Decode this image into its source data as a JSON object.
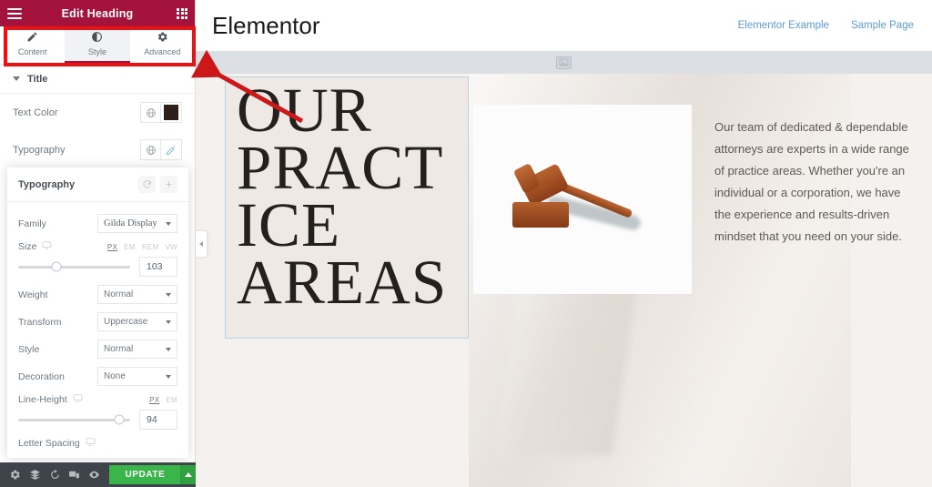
{
  "panel": {
    "header": {
      "title": "Edit Heading",
      "menu_icon": "hamburger-icon",
      "apps_icon": "grid-apps-icon"
    },
    "tabs": [
      {
        "label": "Content",
        "icon": "pencil-icon",
        "active": false
      },
      {
        "label": "Style",
        "icon": "contrast-icon",
        "active": true
      },
      {
        "label": "Advanced",
        "icon": "gear-icon",
        "active": false
      }
    ],
    "section": {
      "label": "Title"
    },
    "controls": [
      {
        "label": "Text Color",
        "globe_icon": "globe-icon",
        "swatch_color": "#2e2019"
      },
      {
        "label": "Typography",
        "globe_icon": "globe-icon",
        "edit_icon": "pencil-edit-icon"
      }
    ],
    "typography_popover": {
      "title": "Typography",
      "reset_icon": "reset-icon",
      "add_icon": "plus-icon",
      "fields": {
        "family": {
          "label": "Family",
          "value": "Gilda Display"
        },
        "size": {
          "label": "Size",
          "responsive_icon": "monitor-icon",
          "units": [
            "PX",
            "EM",
            "REM",
            "VW"
          ],
          "active_unit": "PX",
          "value": "103",
          "slider_percent": 34
        },
        "weight": {
          "label": "Weight",
          "value": "Normal"
        },
        "transform": {
          "label": "Transform",
          "value": "Uppercase"
        },
        "style": {
          "label": "Style",
          "value": "Normal"
        },
        "decoration": {
          "label": "Decoration",
          "value": "None"
        },
        "line_height": {
          "label": "Line-Height",
          "responsive_icon": "monitor-icon",
          "units": [
            "PX",
            "EM"
          ],
          "active_unit": "PX",
          "value": "94",
          "slider_percent": 90
        },
        "letter_spacing": {
          "label": "Letter Spacing",
          "responsive_icon": "monitor-icon"
        }
      }
    },
    "collapse_tab": {
      "icon": "chevron-left-icon"
    }
  },
  "bottom_bar": {
    "icons": [
      {
        "name": "settings-gear-icon"
      },
      {
        "name": "navigator-layers-icon"
      },
      {
        "name": "history-icon"
      },
      {
        "name": "responsive-mode-icon"
      },
      {
        "name": "preview-eye-icon"
      }
    ],
    "update_label": "UPDATE",
    "update_caret_icon": "caret-up-icon",
    "update_color": "#39b54a"
  },
  "preview": {
    "site_header": {
      "title": "Elementor",
      "nav": [
        {
          "label": "Elementor Example"
        },
        {
          "label": "Sample Page"
        }
      ],
      "nav_color": "#5b9dd9"
    },
    "gray_strip": {
      "placeholder_icon": "image-placeholder-icon"
    },
    "heading": {
      "text": "OUR PRACT ICE AREAS",
      "selected": true,
      "selection_color": "#b7d5e0"
    },
    "image_card": {
      "alt_icon": "gavel-image"
    },
    "paragraph": "Our team of dedicated & dependable attorneys are experts in a wide range of practice areas. Whether you're an individual or a corporation, we have the experience and results-driven mindset that you need on your side."
  },
  "annotations": {
    "highlight_box": {
      "target": "panel-tabs",
      "color": "#ee1111"
    },
    "arrow": {
      "color": "#cc1818",
      "points_to": "style-tab"
    }
  }
}
